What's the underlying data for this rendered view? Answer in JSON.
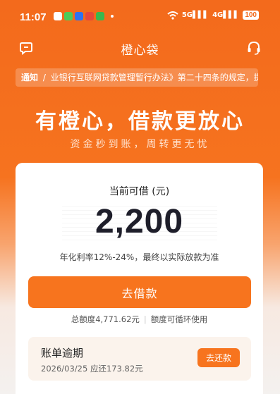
{
  "status_bar": {
    "time": "11:07",
    "signal_1": "5G",
    "signal_2": "4G",
    "battery": "100",
    "app_icons": [
      "message-app-icon",
      "phone-app-icon",
      "alipay-app-icon",
      "app-icon",
      "security-app-icon"
    ]
  },
  "nav": {
    "title": "橙心袋",
    "left_icon": "message-bubble-icon",
    "right_icon": "headset-icon"
  },
  "notice": {
    "tag": "通知",
    "separator": "/",
    "text": "业银行互联网贷款管理暂行办法》第二十四条的规定，提"
  },
  "hero": {
    "title": "有橙心，借款更放心",
    "subtitle": "资金秒到账，周转更无忧"
  },
  "card": {
    "label": "当前可借 (元)",
    "amount": "2,200",
    "rate_note": "年化利率12%-24%，最终以实际放款为准",
    "borrow_button": "去借款",
    "total_quota": "总额度4,771.62元",
    "quota_note": "额度可循环使用"
  },
  "overdue": {
    "title": "账单逾期",
    "detail": "2026/03/25 应还173.82元",
    "repay_button": "去还款"
  },
  "colors": {
    "brand_orange": "#F7741E",
    "text_dark": "#1E1E2A"
  }
}
